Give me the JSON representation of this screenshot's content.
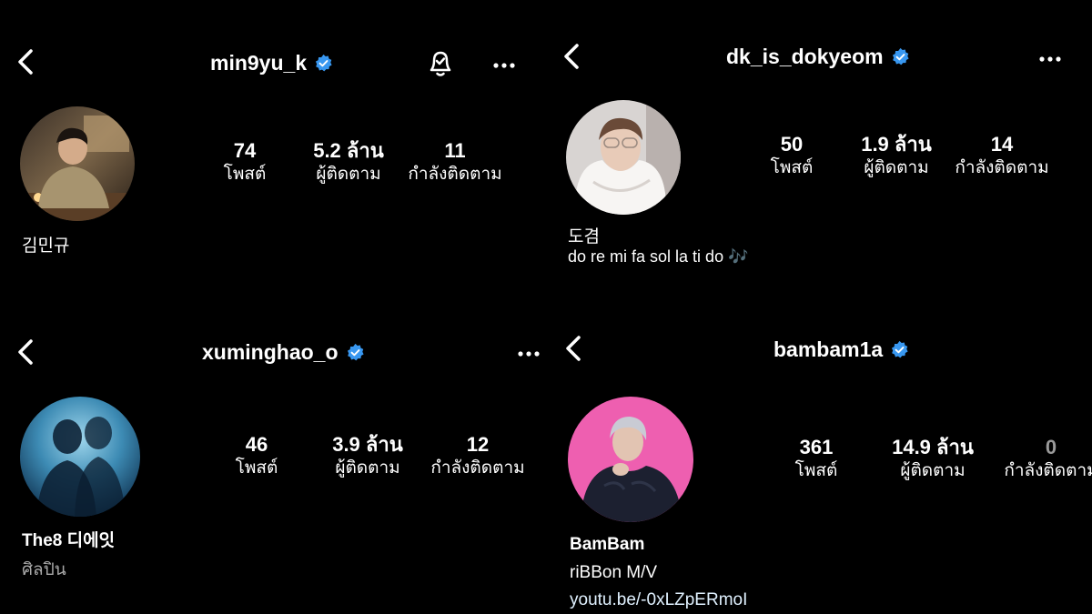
{
  "panels": [
    {
      "handle": "min9yu_k",
      "stats": [
        {
          "value": "74",
          "label": "โพสต์"
        },
        {
          "value": "5.2 ล้าน",
          "label": "ผู้ติดตาม"
        },
        {
          "value": "11",
          "label": "กำลังติดตาม"
        }
      ],
      "name": "김민규"
    },
    {
      "handle": "dk_is_dokyeom",
      "stats": [
        {
          "value": "50",
          "label": "โพสต์"
        },
        {
          "value": "1.9 ล้าน",
          "label": "ผู้ติดตาม"
        },
        {
          "value": "14",
          "label": "กำลังติดตาม"
        }
      ],
      "name": "도겸",
      "bio": "do re mi fa sol la ti do 🎶"
    },
    {
      "handle": "xuminghao_o",
      "stats": [
        {
          "value": "46",
          "label": "โพสต์"
        },
        {
          "value": "3.9 ล้าน",
          "label": "ผู้ติดตาม"
        },
        {
          "value": "12",
          "label": "กำลังติดตาม"
        }
      ],
      "name": "The8 디에잇",
      "category": "ศิลปิน"
    },
    {
      "handle": "bambam1a",
      "stats": [
        {
          "value": "361",
          "label": "โพสต์"
        },
        {
          "value": "14.9 ล้าน",
          "label": "ผู้ติดตาม"
        },
        {
          "value": "0",
          "label": "กำลังติดตาม"
        }
      ],
      "name": "BamBam",
      "bio": "riBBon M/V",
      "link": "youtu.be/-0xLZpERmoI"
    }
  ],
  "icons": {
    "back": "chevron-left-icon",
    "verified": "verified-badge-icon",
    "more": "more-horizontal-icon",
    "bell": "notification-bell-icon"
  },
  "colors": {
    "background": "#000000",
    "verified": "#3897f0",
    "muted": "#a8a8a8",
    "link": "#e0f1ff"
  }
}
